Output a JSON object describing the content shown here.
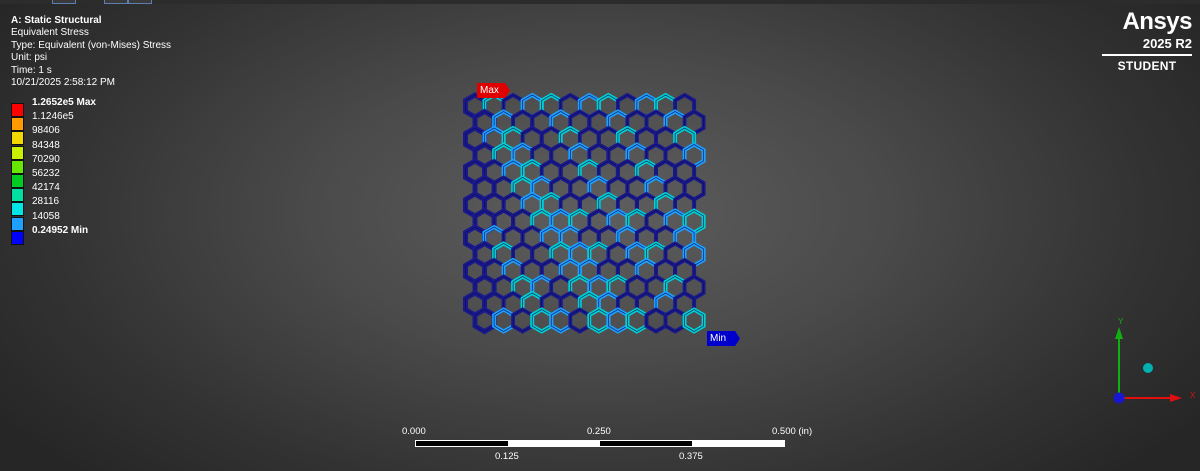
{
  "header": {
    "analysis_title": "A: Static Structural",
    "result_name": "Equivalent Stress",
    "type_line": "Type: Equivalent (von-Mises) Stress",
    "unit_line": "Unit: psi",
    "time_line": "Time: 1 s",
    "timestamp": "10/21/2025 2:58:12 PM"
  },
  "legend": [
    {
      "label": "1.2652e5 Max",
      "color": "#ff0000",
      "bold": true
    },
    {
      "label": "1.1246e5",
      "color": "#ff9a00",
      "bold": false
    },
    {
      "label": "98406",
      "color": "#f2d800",
      "bold": false
    },
    {
      "label": "84348",
      "color": "#c9f200",
      "bold": false
    },
    {
      "label": "70290",
      "color": "#66e600",
      "bold": false
    },
    {
      "label": "56232",
      "color": "#00cc22",
      "bold": false
    },
    {
      "label": "42174",
      "color": "#00e0a0",
      "bold": false
    },
    {
      "label": "28116",
      "color": "#00e6e6",
      "bold": false
    },
    {
      "label": "14058",
      "color": "#1ea0ff",
      "bold": false
    },
    {
      "label": "0.24952 Min",
      "color": "#0000ff",
      "bold": true
    }
  ],
  "logo": {
    "brand": "Ansys",
    "release": "2025 R2",
    "edition": "STUDENT"
  },
  "probes": {
    "max_label": "Max",
    "min_label": "Min"
  },
  "scale_bar": {
    "label_0": "0.000",
    "label_125": "0.125",
    "label_250": "0.250",
    "label_375": "0.375",
    "label_500": "0.500 (in)"
  },
  "triad": {
    "x_label": "X",
    "y_label": "Y",
    "colors": {
      "x": "#e01010",
      "y": "#10b010",
      "z": "#1010e0",
      "iso": "#00b0b0"
    }
  },
  "model_colors": {
    "low": "#1a1a8c",
    "edge": "#0a0a55",
    "mid": "#1ea0ff",
    "high": "#00d0d0"
  }
}
